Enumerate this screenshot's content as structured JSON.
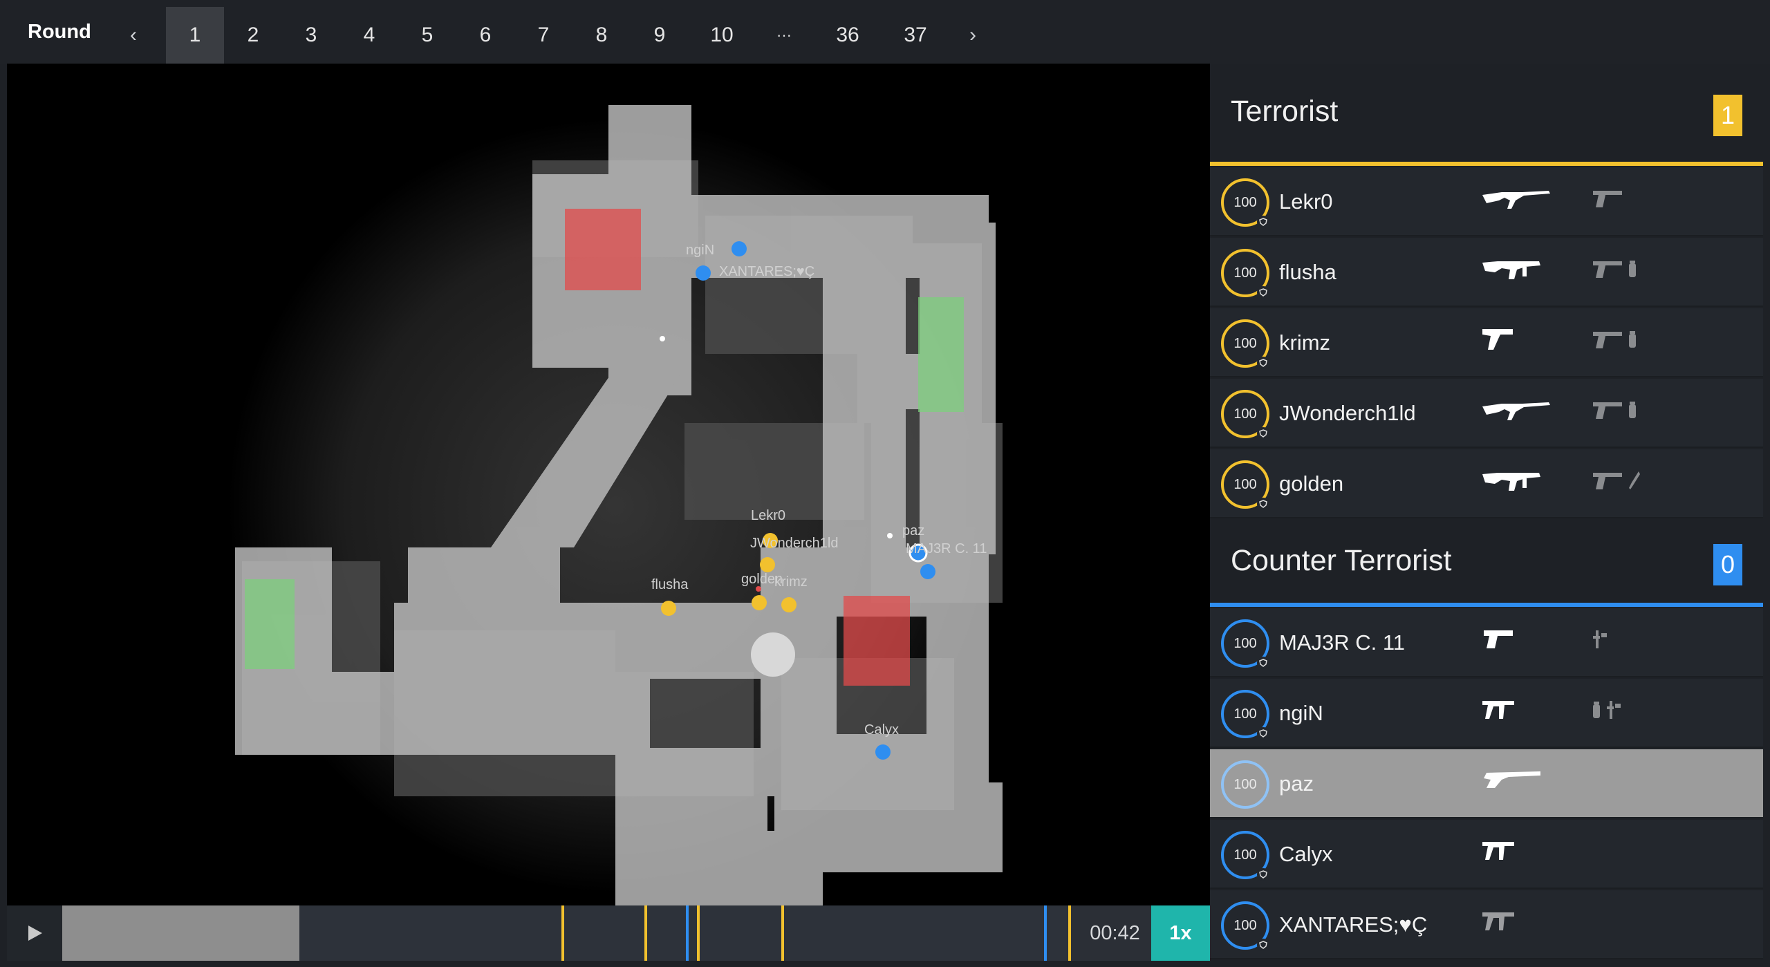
{
  "nav": {
    "round_label": "Round",
    "prev_arrow": "‹",
    "next_arrow": "›",
    "pages": [
      "1",
      "2",
      "3",
      "4",
      "5",
      "6",
      "7",
      "8",
      "9",
      "10",
      "···",
      "36",
      "37"
    ],
    "active_page": "1"
  },
  "map": {
    "labels": [
      "ngiN",
      "XANTARES;♥Ç",
      "Lekr0",
      "JWonderch1ld",
      "paz",
      "MAJ3R C. 11",
      "flusha",
      "golden",
      "krimz",
      "Calyx"
    ],
    "colors": {
      "terrorist": "#f2c12e",
      "counter_terrorist": "#2f8ef0",
      "bombsite": "#e24b4b",
      "spawn": "#7ad17a"
    }
  },
  "timeline": {
    "time": "00:42",
    "speed": "1x",
    "progress": 0.235,
    "event_colors": [
      "#f2c12e",
      "#f2c12e",
      "#2f8ef0",
      "#f2c12e",
      "#f2c12e",
      "#2f8ef0",
      "#f2c12e"
    ]
  },
  "terrorist": {
    "name": "Terrorist",
    "score": "1",
    "color": "#f2c12e",
    "players": [
      {
        "name": "Lekr0",
        "hp": "100",
        "weapon": "ak47-icon",
        "utility": [
          "pistol-icon"
        ]
      },
      {
        "name": "flusha",
        "hp": "100",
        "weapon": "mp9-icon",
        "utility": [
          "pistol-icon",
          "grenade-icon"
        ]
      },
      {
        "name": "krimz",
        "hp": "100",
        "weapon": "tec9-icon",
        "utility": [
          "pistol-icon",
          "grenade-icon"
        ]
      },
      {
        "name": "JWonderch1ld",
        "hp": "100",
        "weapon": "ak47-icon",
        "utility": [
          "pistol-icon",
          "grenade-icon"
        ]
      },
      {
        "name": "golden",
        "hp": "100",
        "weapon": "mp9-icon",
        "utility": [
          "pistol-icon",
          "knife-icon"
        ]
      }
    ]
  },
  "counter_terrorist": {
    "name": "Counter Terrorist",
    "score": "0",
    "color": "#2f8ef0",
    "players": [
      {
        "name": "MAJ3R C. 11",
        "hp": "100",
        "weapon": "deagle-icon",
        "utility": [
          "defuse-kit-icon"
        ]
      },
      {
        "name": "ngiN",
        "hp": "100",
        "weapon": "mp7-icon",
        "utility": [
          "grenade-icon",
          "defuse-kit-icon"
        ]
      },
      {
        "name": "paz",
        "hp": "100",
        "weapon": "scout-icon",
        "utility": []
      },
      {
        "name": "Calyx",
        "hp": "100",
        "weapon": "mp7-icon",
        "utility": []
      },
      {
        "name": "XANTARES;♥Ç",
        "hp": "100",
        "weapon": "mp7-icon",
        "utility": []
      }
    ]
  }
}
